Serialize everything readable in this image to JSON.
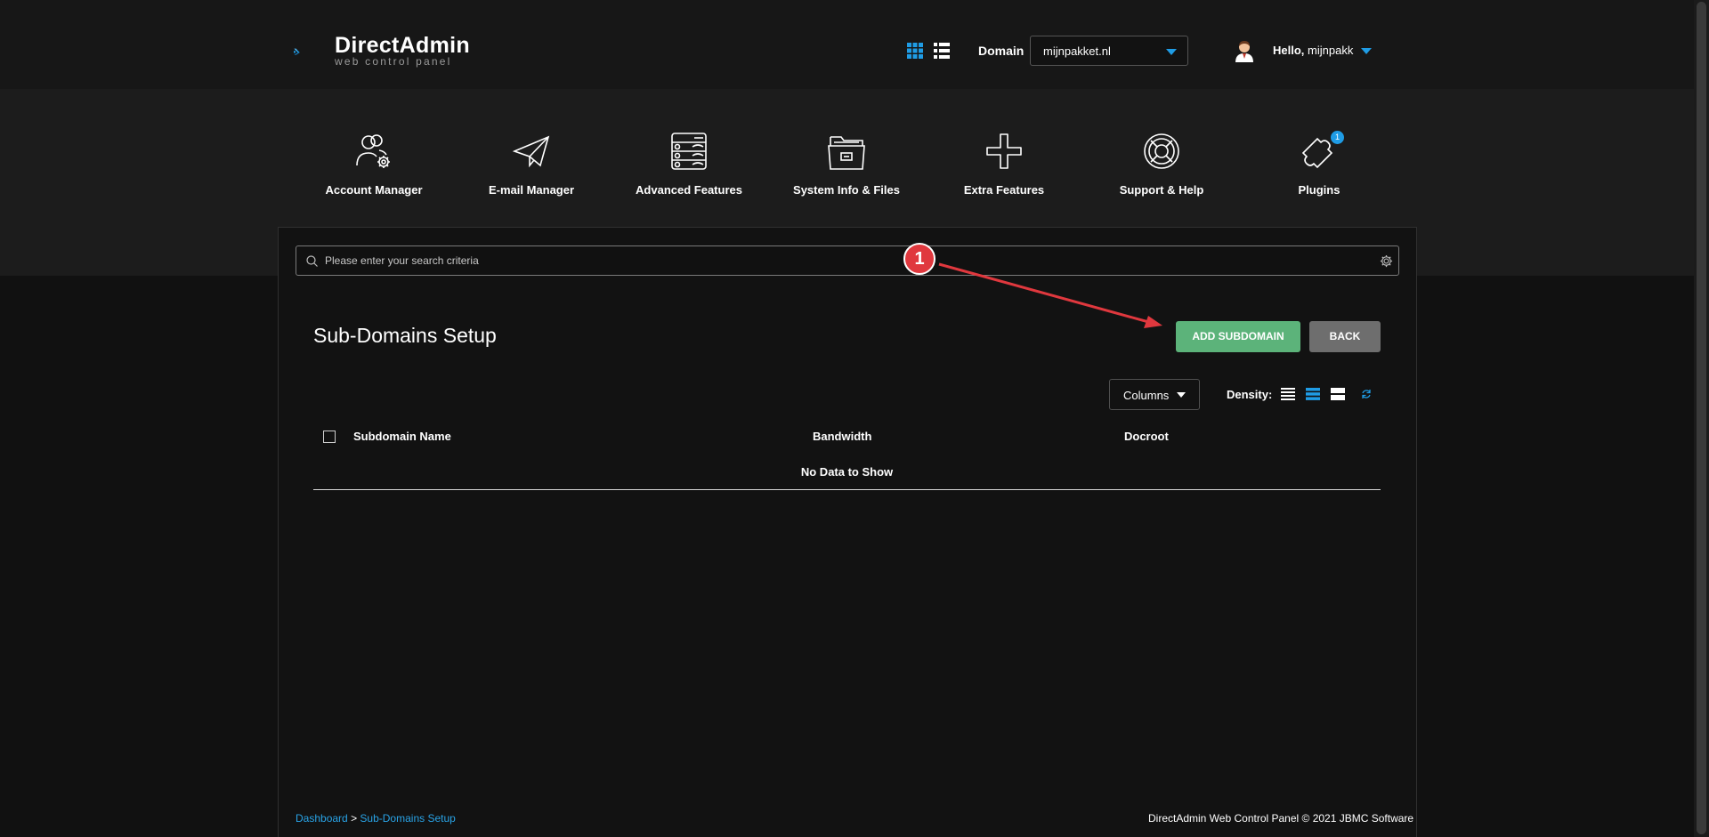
{
  "header": {
    "logo_title": "DirectAdmin",
    "logo_subtitle": "web control panel",
    "view_grid_icon": "grid-icon",
    "view_list_icon": "list-icon",
    "domain_label": "Domain",
    "domain_value": "mijnpakket.nl",
    "hello_prefix": "Hello,",
    "hello_user": "mijnpakk",
    "accent_color": "#1f9ce5"
  },
  "nav": {
    "items": [
      {
        "label": "Account Manager",
        "icon": "users-gear-icon"
      },
      {
        "label": "E-mail Manager",
        "icon": "paper-plane-icon"
      },
      {
        "label": "Advanced Features",
        "icon": "server-stack-icon"
      },
      {
        "label": "System Info & Files",
        "icon": "folder-icon"
      },
      {
        "label": "Extra Features",
        "icon": "plus-icon"
      },
      {
        "label": "Support & Help",
        "icon": "lifebuoy-icon"
      },
      {
        "label": "Plugins",
        "icon": "puzzle-icon",
        "badge": "1"
      }
    ]
  },
  "search": {
    "placeholder": "Please enter your search criteria"
  },
  "main": {
    "title": "Sub-Domains Setup",
    "add_button": "ADD SUBDOMAIN",
    "back_button": "BACK",
    "add_button_color": "#5cb37a",
    "back_button_color": "#6e6e6e"
  },
  "table": {
    "columns_button": "Columns",
    "density_label": "Density:",
    "headers": [
      "Subdomain Name",
      "Bandwidth",
      "Docroot"
    ],
    "empty_text": "No Data to Show"
  },
  "footer": {
    "crumbs": [
      "Dashboard",
      "Sub-Domains Setup"
    ],
    "separator": ">",
    "copyright": "DirectAdmin Web Control Panel © 2021 JBMC Software"
  },
  "annotation": {
    "step": "1",
    "color": "#e0383e"
  }
}
